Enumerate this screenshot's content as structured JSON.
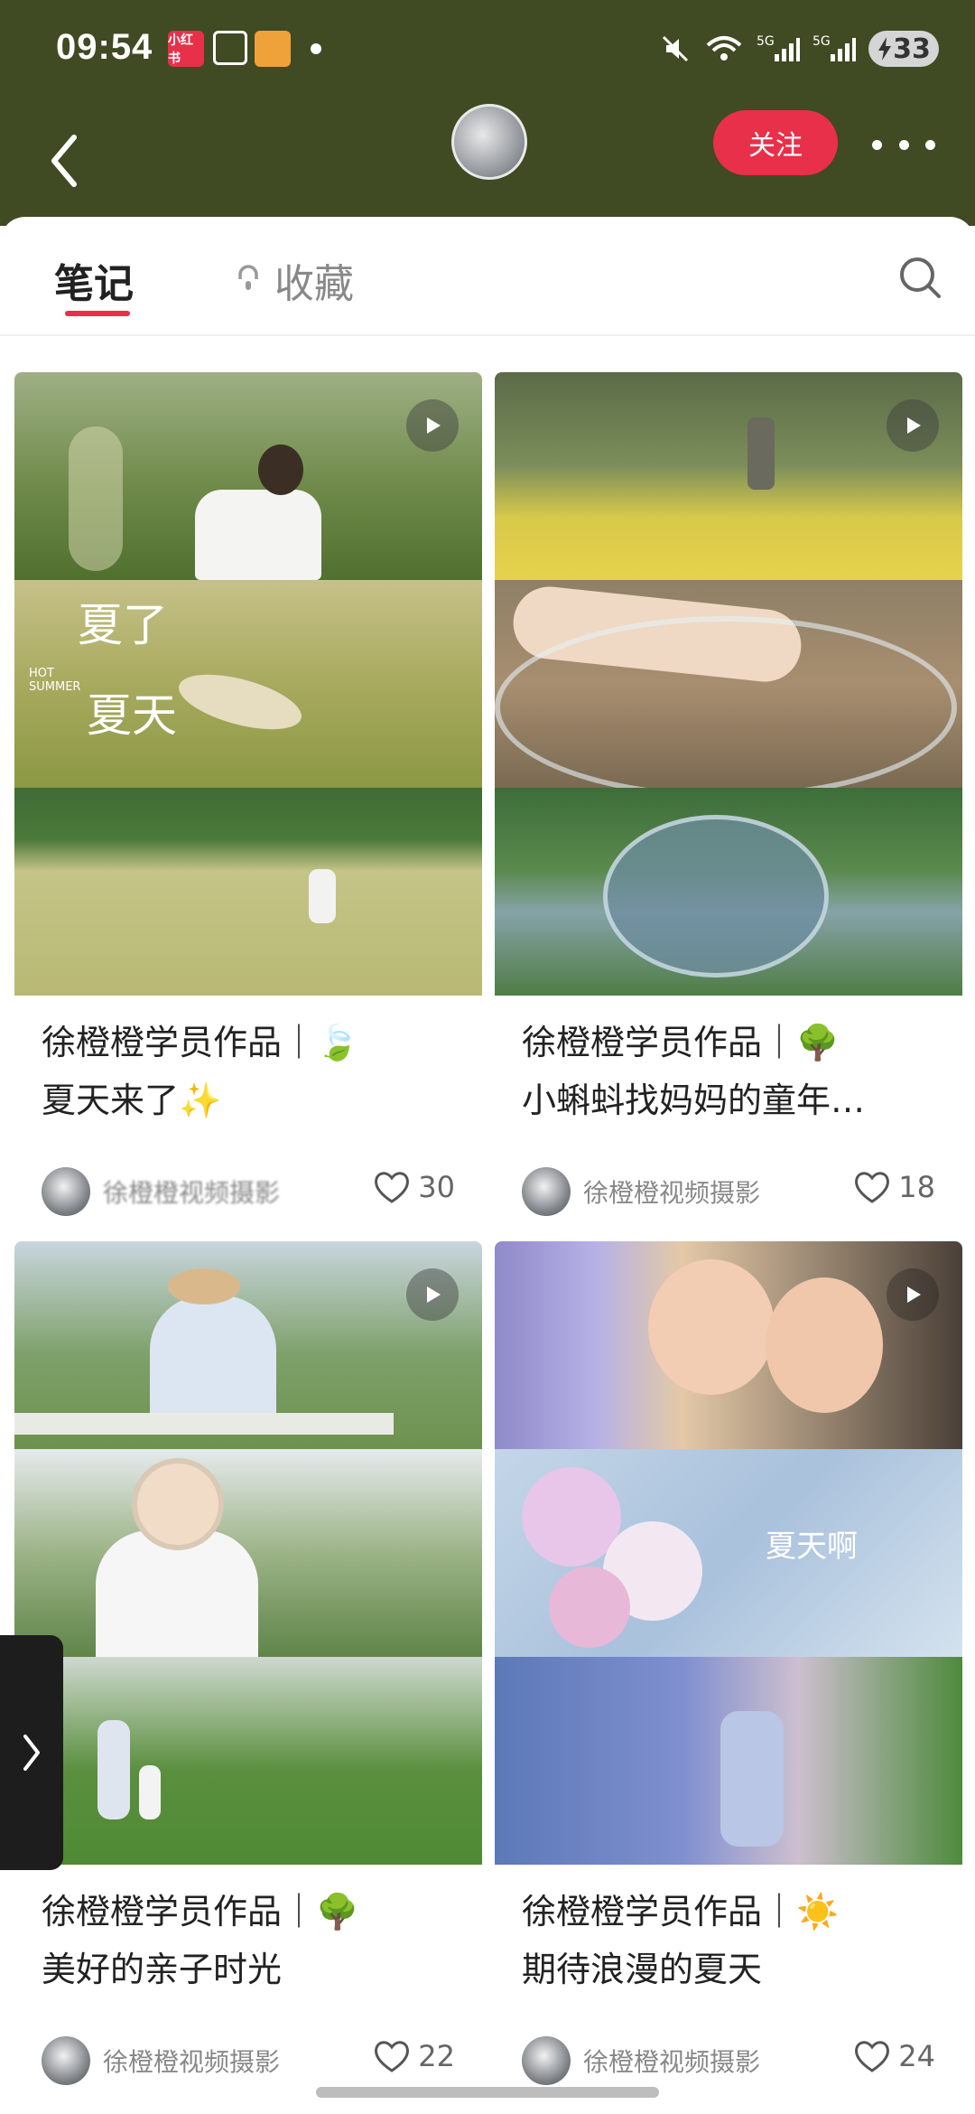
{
  "status_bar": {
    "time": "09:54",
    "app_badge_1": "小红书",
    "battery": "33"
  },
  "nav": {
    "follow_label": "关注"
  },
  "tabs": {
    "notes": "笔记",
    "favorites": "收藏"
  },
  "cards": [
    {
      "title_line1": "徐橙橙学员作品｜🍃",
      "title_line2": "夏天来了✨",
      "author": "徐橙橙视频摄影",
      "likes": "30"
    },
    {
      "title_line1": "徐橙橙学员作品｜🌳",
      "title_line2": "小蝌蚪找妈妈的童年…",
      "author": "徐橙橙视频摄影",
      "likes": "18"
    },
    {
      "title_line1": "徐橙橙学员作品｜🌳",
      "title_line2": "美好的亲子时光",
      "author": "徐橙橙视频摄影",
      "likes": "22"
    },
    {
      "title_line1": "徐橙橙学员作品｜☀️",
      "title_line2": "期待浪漫的夏天",
      "author": "徐橙橙视频摄影",
      "likes": "24"
    }
  ],
  "overlay_texts": {
    "card1_caption_1": "夏了",
    "card1_caption_2": "夏天",
    "card1_caption_small": "HOT SUMMER",
    "card4_caption": "夏天啊"
  },
  "colors": {
    "header_bg": "#404a23",
    "accent_red": "#e8304a"
  }
}
